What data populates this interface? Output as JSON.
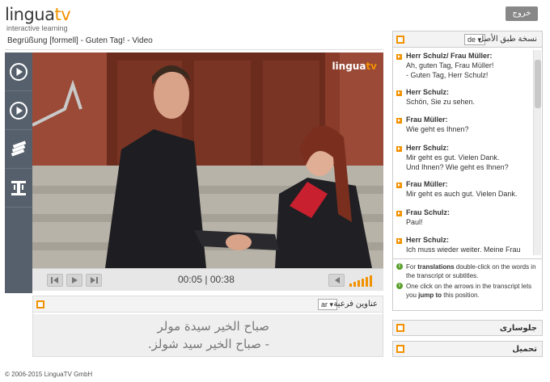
{
  "header": {
    "logo_main": "lingua",
    "logo_tv": "tv",
    "logo_tagline": "interactive learning",
    "exit_label": "خروج"
  },
  "video": {
    "title": "Begrüßung [formell] - Guten Tag! - Video",
    "watermark_main": "lingua",
    "watermark_tv": "tv",
    "time_current": "00:05",
    "time_separator": "|",
    "time_total": "00:38"
  },
  "sidebar": {
    "items": [
      {
        "icon": "play-circle-icon"
      },
      {
        "icon": "play-circle-icon"
      },
      {
        "icon": "books-icon"
      },
      {
        "icon": "dumbbell-icon"
      }
    ]
  },
  "subtitles": {
    "label": "عناوين فرعية",
    "language": "ar",
    "lines": [
      "صباح الخير سيدة مولر",
      "- صباح الخير سيد شولز."
    ]
  },
  "transcript": {
    "label": "نسخة طبق الأصل",
    "language": "de",
    "entries": [
      {
        "speaker": "Herr Schulz/ Frau Müller:",
        "lines": [
          "Ah, guten Tag, Frau Müller!",
          "- Guten Tag, Herr Schulz!"
        ]
      },
      {
        "speaker": "Herr Schulz:",
        "lines": [
          "Schön, Sie zu sehen."
        ]
      },
      {
        "speaker": "Frau Müller:",
        "lines": [
          "Wie geht es Ihnen?"
        ]
      },
      {
        "speaker": "Herr Schulz:",
        "lines": [
          "Mir geht es gut. Vielen Dank.",
          "Und Ihnen? Wie geht es Ihnen?"
        ]
      },
      {
        "speaker": "Frau Müller:",
        "lines": [
          "Mir geht es auch gut. Vielen Dank."
        ]
      },
      {
        "speaker": "Frau Schulz:",
        "lines": [
          "Paul!"
        ]
      },
      {
        "speaker": "Herr Schulz:",
        "lines": [
          "Ich muss wieder weiter. Meine Frau"
        ]
      }
    ],
    "tip1_pre": "For ",
    "tip1_bold": "translations",
    "tip1_post": " double-click on the words in the transcript or subtitles.",
    "tip2_pre": "One click on the arrows in the transcript lets you ",
    "tip2_bold": "jump to",
    "tip2_post": " this position."
  },
  "accordions": {
    "glossary": "جلوسارى",
    "download": "تحميل"
  },
  "footer": {
    "copyright": "© 2006-2015 LinguaTV GmbH"
  },
  "colors": {
    "accent": "#f29100",
    "sidebar": "#56606c",
    "tip_icon": "#5aa02c"
  }
}
